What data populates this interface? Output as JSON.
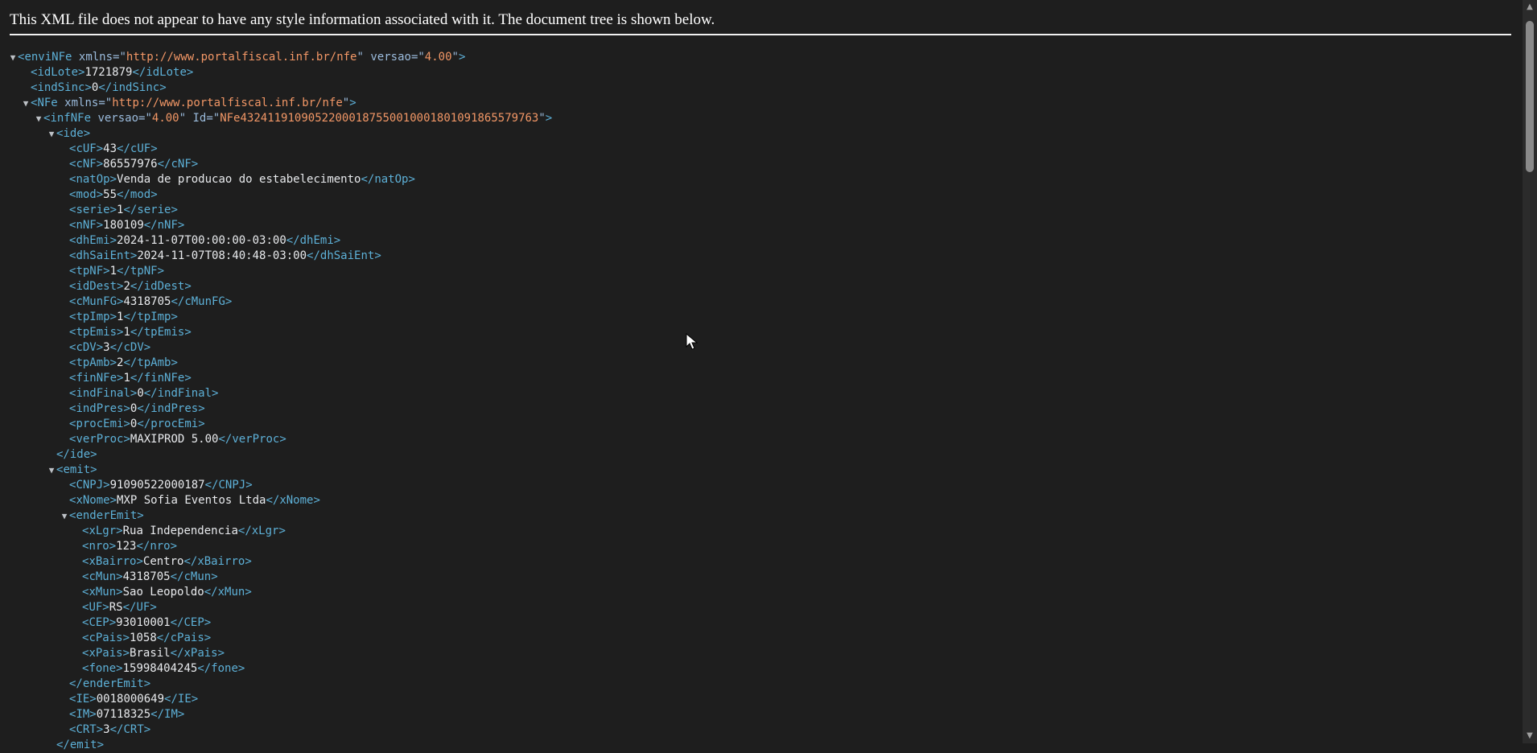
{
  "banner": {
    "message": "This XML file does not appear to have any style information associated with it. The document tree is shown below."
  },
  "tree": [
    {
      "depth": 0,
      "toggle": true,
      "open": true,
      "name": "enviNFe",
      "attrs": [
        {
          "n": "xmlns",
          "v": "http://www.portalfiscal.inf.br/nfe"
        },
        {
          "n": "versao",
          "v": "4.00"
        }
      ]
    },
    {
      "depth": 1,
      "name": "idLote",
      "text": "1721879"
    },
    {
      "depth": 1,
      "name": "indSinc",
      "text": "0"
    },
    {
      "depth": 1,
      "toggle": true,
      "open": true,
      "name": "NFe",
      "attrs": [
        {
          "n": "xmlns",
          "v": "http://www.portalfiscal.inf.br/nfe"
        }
      ]
    },
    {
      "depth": 2,
      "toggle": true,
      "open": true,
      "name": "infNFe",
      "attrs": [
        {
          "n": "versao",
          "v": "4.00"
        },
        {
          "n": "Id",
          "v": "NFe43241191090522000187550010001801091865579763"
        }
      ]
    },
    {
      "depth": 3,
      "toggle": true,
      "open": true,
      "name": "ide"
    },
    {
      "depth": 4,
      "name": "cUF",
      "text": "43"
    },
    {
      "depth": 4,
      "name": "cNF",
      "text": "86557976"
    },
    {
      "depth": 4,
      "name": "natOp",
      "text": "Venda de producao do estabelecimento"
    },
    {
      "depth": 4,
      "name": "mod",
      "text": "55"
    },
    {
      "depth": 4,
      "name": "serie",
      "text": "1"
    },
    {
      "depth": 4,
      "name": "nNF",
      "text": "180109"
    },
    {
      "depth": 4,
      "name": "dhEmi",
      "text": "2024-11-07T00:00:00-03:00"
    },
    {
      "depth": 4,
      "name": "dhSaiEnt",
      "text": "2024-11-07T08:40:48-03:00"
    },
    {
      "depth": 4,
      "name": "tpNF",
      "text": "1"
    },
    {
      "depth": 4,
      "name": "idDest",
      "text": "2"
    },
    {
      "depth": 4,
      "name": "cMunFG",
      "text": "4318705"
    },
    {
      "depth": 4,
      "name": "tpImp",
      "text": "1"
    },
    {
      "depth": 4,
      "name": "tpEmis",
      "text": "1"
    },
    {
      "depth": 4,
      "name": "cDV",
      "text": "3"
    },
    {
      "depth": 4,
      "name": "tpAmb",
      "text": "2"
    },
    {
      "depth": 4,
      "name": "finNFe",
      "text": "1"
    },
    {
      "depth": 4,
      "name": "indFinal",
      "text": "0"
    },
    {
      "depth": 4,
      "name": "indPres",
      "text": "0"
    },
    {
      "depth": 4,
      "name": "procEmi",
      "text": "0"
    },
    {
      "depth": 4,
      "name": "verProc",
      "text": "MAXIPROD 5.00"
    },
    {
      "depth": 3,
      "close": true,
      "name": "ide"
    },
    {
      "depth": 3,
      "toggle": true,
      "open": true,
      "name": "emit"
    },
    {
      "depth": 4,
      "name": "CNPJ",
      "text": "91090522000187"
    },
    {
      "depth": 4,
      "name": "xNome",
      "text": "MXP Sofia Eventos Ltda"
    },
    {
      "depth": 4,
      "toggle": true,
      "open": true,
      "name": "enderEmit"
    },
    {
      "depth": 5,
      "name": "xLgr",
      "text": "Rua Independencia"
    },
    {
      "depth": 5,
      "name": "nro",
      "text": "123"
    },
    {
      "depth": 5,
      "name": "xBairro",
      "text": "Centro"
    },
    {
      "depth": 5,
      "name": "cMun",
      "text": "4318705"
    },
    {
      "depth": 5,
      "name": "xMun",
      "text": "Sao Leopoldo"
    },
    {
      "depth": 5,
      "name": "UF",
      "text": "RS"
    },
    {
      "depth": 5,
      "name": "CEP",
      "text": "93010001"
    },
    {
      "depth": 5,
      "name": "cPais",
      "text": "1058"
    },
    {
      "depth": 5,
      "name": "xPais",
      "text": "Brasil"
    },
    {
      "depth": 5,
      "name": "fone",
      "text": "15998404245"
    },
    {
      "depth": 4,
      "close": true,
      "name": "enderEmit"
    },
    {
      "depth": 4,
      "name": "IE",
      "text": "0018000649"
    },
    {
      "depth": 4,
      "name": "IM",
      "text": "07118325"
    },
    {
      "depth": 4,
      "name": "CRT",
      "text": "3"
    },
    {
      "depth": 3,
      "close": true,
      "name": "emit"
    }
  ],
  "icons": {
    "toggle_open": "triangle-down-icon",
    "scroll_up": "arrow-up-icon",
    "scroll_down": "arrow-down-icon",
    "cursor": "mouse-pointer-icon"
  },
  "colors": {
    "background": "#1e1e1e",
    "tag": "#5db0d7",
    "attr_name": "#9bbbdc",
    "attr_value": "#f29766",
    "text": "#e8eaed"
  }
}
